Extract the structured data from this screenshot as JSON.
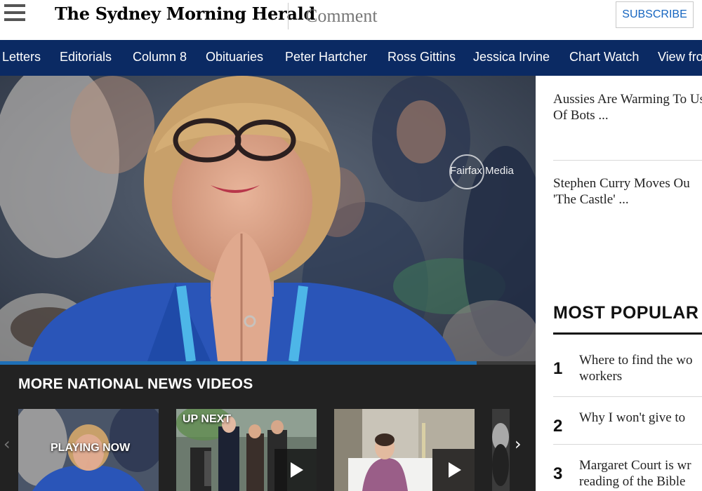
{
  "header": {
    "masthead": "The Sydney Morning Herald",
    "section": "Comment",
    "subscribe_label": "SUBSCRIBE"
  },
  "nav": {
    "items": [
      "Letters",
      "Editorials",
      "Column 8",
      "Obituaries",
      "Peter Hartcher",
      "Ross Gittins",
      "Jessica Irvine",
      "Chart Watch",
      "View fro"
    ]
  },
  "hero": {
    "watermark": "Fairfax Media"
  },
  "video_strip": {
    "title": "MORE NATIONAL NEWS VIDEOS",
    "progress": 0.89,
    "thumbs": [
      {
        "label": "PLAYING NOW",
        "has_play": false
      },
      {
        "label": "UP NEXT",
        "has_play": true
      },
      {
        "label": "",
        "has_play": true
      }
    ]
  },
  "sidebar": {
    "stories": [
      "Aussies Are Warming To Use Of Bots ...",
      "Stephen Curry Moves Ou 'The Castle' ..."
    ],
    "most_popular_title": "MOST POPULAR",
    "most_popular": [
      {
        "num": "1",
        "text": "Where to find the wo workers"
      },
      {
        "num": "2",
        "text": "Why I won't give to"
      },
      {
        "num": "3",
        "text": "Margaret Court is wr reading of the Bible"
      }
    ]
  },
  "colors": {
    "nav_bg": "#0b2a63",
    "strip_bg": "#222222",
    "accent_blue": "#1565c0",
    "progress_blue": "#1e6fb6"
  },
  "icons": {
    "menu": "hamburger-icon",
    "prev": "chevron-left-icon",
    "next": "chevron-right-icon",
    "play": "play-icon"
  }
}
